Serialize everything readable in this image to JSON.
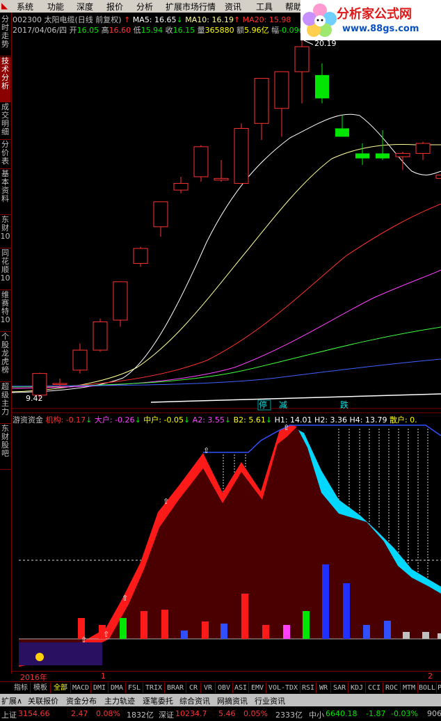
{
  "menu": {
    "items": [
      "系统",
      "功能",
      "深度",
      "报价",
      "分析",
      "扩展市场行情",
      "资讯",
      "工具",
      "帮助"
    ]
  },
  "logo": {
    "title": "分析家公式网",
    "url_text": "www.88gs.com"
  },
  "sidebar": {
    "tabs": [
      "分时走势",
      "技术分析",
      "成交明细",
      "分价表",
      "基本资料",
      "东财10",
      "同花顺10",
      "维赛特10",
      "个股龙虎榜",
      "超级主力",
      "东财股吧"
    ],
    "active": 1
  },
  "info": {
    "stock": "002300 太阳电缆(日线 前复权)",
    "ma5": "MA5: 16.65",
    "ma10": "MA10: 16.19",
    "ma20": "MA20: 15.98",
    "date": "2017/04/06/四",
    "open_label": "开",
    "open": "16.05",
    "high_label": "高",
    "high": "16.60",
    "low_label": "低",
    "low": "15.94",
    "close_label": "收",
    "close": "16.15",
    "vol_label": "量",
    "vol": "365880",
    "amt_label": "额",
    "amt": "5.96亿",
    "amp_label": "幅",
    "amp": "-0.09("
  },
  "price_chart": {
    "high_label": "20.19",
    "low_label": "9.42",
    "annotations": [
      "停",
      "减",
      "跌"
    ],
    "candles": [
      {
        "o": 9.55,
        "c": 10.2,
        "h": 10.22,
        "l": 9.42
      },
      {
        "o": 9.9,
        "c": 9.9,
        "h": 10.05,
        "l": 9.8
      },
      {
        "o": 10.3,
        "c": 10.9,
        "h": 11.1,
        "l": 10.2
      },
      {
        "o": 10.9,
        "c": 11.75,
        "h": 11.85,
        "l": 10.85
      },
      {
        "o": 11.8,
        "c": 12.95,
        "h": 12.95,
        "l": 11.6
      },
      {
        "o": 13.5,
        "c": 13.95,
        "h": 14.0,
        "l": 13.4
      },
      {
        "o": 14.6,
        "c": 15.35,
        "h": 15.35,
        "l": 14.3
      },
      {
        "o": 15.7,
        "c": 15.9,
        "h": 16.1,
        "l": 15.6
      },
      {
        "o": 16.1,
        "c": 17.0,
        "h": 17.05,
        "l": 15.95
      },
      {
        "o": 16.0,
        "c": 16.05,
        "h": 16.6,
        "l": 15.95
      },
      {
        "o": 15.9,
        "c": 17.55,
        "h": 17.7,
        "l": 15.9
      },
      {
        "o": 17.7,
        "c": 19.05,
        "h": 19.05,
        "l": 17.2
      },
      {
        "o": 18.15,
        "c": 19.25,
        "h": 19.25,
        "l": 17.3
      },
      {
        "o": 19.25,
        "c": 20.0,
        "h": 20.19,
        "l": 18.3
      },
      {
        "o": 19.15,
        "c": 18.45,
        "h": 19.5,
        "l": 18.3
      },
      {
        "o": 17.55,
        "c": 17.3,
        "h": 17.95,
        "l": 17.3
      },
      {
        "o": 16.8,
        "c": 16.65,
        "h": 17.1,
        "l": 16.45
      },
      {
        "o": 16.8,
        "c": 16.65,
        "h": 17.5,
        "l": 16.6
      },
      {
        "o": 16.7,
        "c": 16.8,
        "h": 16.85,
        "l": 16.3
      },
      {
        "o": 16.8,
        "c": 17.1,
        "h": 17.15,
        "l": 16.6
      },
      {
        "o": 16.05,
        "c": 16.15,
        "h": 16.6,
        "l": 15.94
      }
    ],
    "ma5_color": "#ffffff",
    "ma10_color": "#ffff99",
    "ma20_color": "#ff3030"
  },
  "indicator": {
    "name": "游资资金",
    "jg_label": "机构: -0.17",
    "dh_label": "大户: -0.26",
    "zh_label": "中户: -0.05",
    "a2_label": "A2: 3.55",
    "b2_label": "B2: 5.61",
    "h1_label": "H1: 14.01",
    "h2_label": "H2: 3.36",
    "h4_label": "H4: 13.79",
    "sh_label": "散户: 0."
  },
  "timeline": {
    "year": "2016年",
    "m1": "1",
    "m2": "2"
  },
  "bottom_tabs": {
    "items": [
      "指标",
      "模板",
      "全部",
      "MACD",
      "DMI",
      "DMA",
      "FSL",
      "TRIX",
      "BRAR",
      "CR",
      "VR",
      "OBV",
      "ASI",
      "EMV",
      "VOL-TDX",
      "RSI",
      "WR",
      "SAR",
      "KDJ",
      "CCI",
      "ROC",
      "MTM",
      "BOLL",
      "PSY"
    ],
    "active": 2
  },
  "row2": {
    "items": [
      "扩展∧",
      "关联报价",
      "资金分布",
      "主力轨迹",
      "逐笔委托",
      "综合资讯",
      "网摘资讯",
      "行业资讯"
    ]
  },
  "ticker": {
    "sh_name": "上证",
    "sh_val": "3154.66",
    "sh_chg": "2.47",
    "sh_pct": "0.08%",
    "sh_amt": "1832亿",
    "sz_name": "深证",
    "sz_val": "10234.7",
    "sz_chg": "5.46",
    "sz_pct": "0.05%",
    "sz_amt": "2333亿",
    "zx_name": "中小",
    "zx_val": "6640.18",
    "zx_chg": "-1.87",
    "zx_pct": "-0.03%",
    "zx_amt": "906"
  },
  "colors": {
    "up": "#ff3232",
    "down": "#00e600",
    "cyan": "#00d8ff",
    "frame": "#800000"
  }
}
